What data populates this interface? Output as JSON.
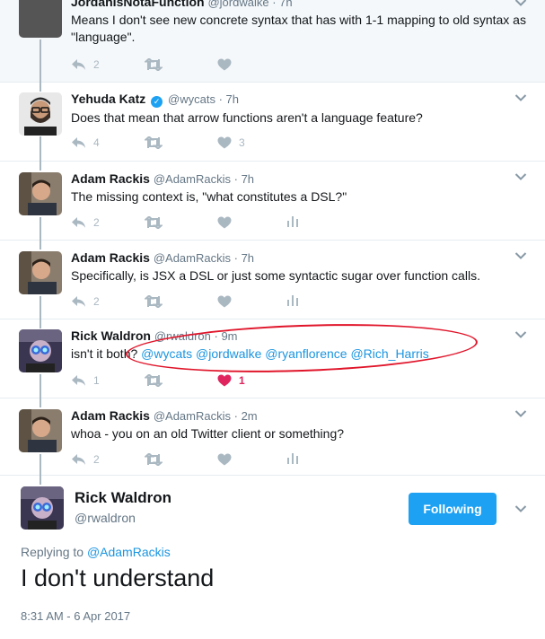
{
  "tweets": [
    {
      "name": "JordanIsNotaFunction",
      "handle": "@jordwalke",
      "time": "7h",
      "text": "Means I don't see new concrete syntax that has with 1-1 mapping to old syntax as \"language\".",
      "replies": "2",
      "likes": ""
    },
    {
      "name": "Yehuda Katz",
      "handle": "@wycats",
      "time": "7h",
      "text": "Does that mean that arrow functions aren't a language feature?",
      "replies": "4",
      "likes": "3"
    },
    {
      "name": "Adam Rackis",
      "handle": "@AdamRackis",
      "time": "7h",
      "text": "The missing context is, \"what constitutes a DSL?\"",
      "replies": "2",
      "likes": ""
    },
    {
      "name": "Adam Rackis",
      "handle": "@AdamRackis",
      "time": "7h",
      "text": "Specifically, is JSX a DSL or just some syntactic sugar over function calls.",
      "replies": "2",
      "likes": ""
    },
    {
      "name": "Rick Waldron",
      "handle": "@rwaldron",
      "time": "9m",
      "text_prefix": "isn't it both? ",
      "mentions": "@wycats @jordwalke @ryanflorence @Rich_Harris",
      "replies": "1",
      "likes": "1"
    },
    {
      "name": "Adam Rackis",
      "handle": "@AdamRackis",
      "time": "2m",
      "text": "whoa - you on an old Twitter client or something?",
      "replies": "2",
      "likes": ""
    }
  ],
  "main_tweet": {
    "name": "Rick Waldron",
    "handle": "@rwaldron",
    "follow_label": "Following",
    "replying_prefix": "Replying to ",
    "replying_to": "@AdamRackis",
    "text": "I don't understand",
    "timestamp": "8:31 AM - 6 Apr 2017"
  },
  "separator": " · ",
  "colors": {
    "link": "#1b95e0",
    "accent": "#1da1f2",
    "like": "#e0245e",
    "annotation": "#e0152a"
  }
}
